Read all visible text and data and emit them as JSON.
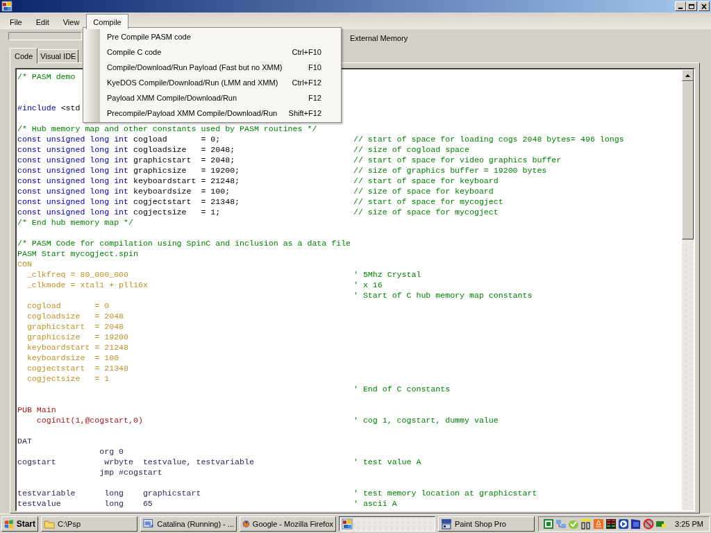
{
  "progress": {
    "level": 0
  },
  "menus": [
    {
      "label": "File",
      "selected": false
    },
    {
      "label": "Edit",
      "selected": false
    },
    {
      "label": "View",
      "selected": false
    },
    {
      "label": "Compile",
      "selected": true,
      "items": [
        {
          "label": "Pre Compile PASM code"
        },
        {
          "label": "Compile C code",
          "shortcut": "Ctrl+F10"
        },
        {
          "label": "Compile/Download/Run Payload (Fast but no XMM)",
          "shortcut": "F10"
        },
        {
          "label": "KyeDOS Compile/Download/Run (LMM and XMM)",
          "shortcut": "Ctrl+F12"
        },
        {
          "label": "Payload XMM Compile/Download/Run",
          "shortcut": "F12"
        },
        {
          "label": "Precompile/Payload XMM Compile/Download/Run",
          "shortcut": "Shift+F12"
        }
      ]
    }
  ],
  "toolbar": {
    "option_label": "External Memory"
  },
  "tabs": [
    {
      "label": "Code",
      "selected": true
    },
    {
      "label": "Visual IDE",
      "selected": false
    }
  ],
  "code_lines": [
    {
      "segments": [
        {
          "kind": "comment",
          "text": "/* PASM demo"
        }
      ]
    },
    {
      "kind": "blank"
    },
    {
      "kind": "blank"
    },
    {
      "segments": [
        {
          "kind": "keyword",
          "text": "#include"
        },
        {
          "kind": "plain",
          "text": " <std"
        }
      ]
    },
    {
      "kind": "blank"
    },
    {
      "segments": [
        {
          "kind": "comment",
          "text": "/* Hub memory map and other constants used by PASM routines */"
        }
      ]
    },
    {
      "segments": [
        {
          "kind": "keyword",
          "text": "const unsigned long int"
        },
        {
          "kind": "plain",
          "text": " cogload       = 0;"
        }
      ],
      "note": "// start of space for loading cogs 2048 bytes= 496 longs"
    },
    {
      "segments": [
        {
          "kind": "keyword",
          "text": "const unsigned long int"
        },
        {
          "kind": "plain",
          "text": " cogloadsize   = 2048;"
        }
      ],
      "note": "// size of cogload space"
    },
    {
      "segments": [
        {
          "kind": "keyword",
          "text": "const unsigned long int"
        },
        {
          "kind": "plain",
          "text": " graphicstart  = 2048;"
        }
      ],
      "note": "// start of space for video graphics buffer"
    },
    {
      "segments": [
        {
          "kind": "keyword",
          "text": "const unsigned long int"
        },
        {
          "kind": "plain",
          "text": " graphicsize   = 19200;"
        }
      ],
      "note": "// size of graphics buffer = 19200 bytes"
    },
    {
      "segments": [
        {
          "kind": "keyword",
          "text": "const unsigned long int"
        },
        {
          "kind": "plain",
          "text": " keyboardstart = 21248;"
        }
      ],
      "note": "// start of space for keyboard"
    },
    {
      "segments": [
        {
          "kind": "keyword",
          "text": "const unsigned long int"
        },
        {
          "kind": "plain",
          "text": " keyboardsize  = 100;"
        }
      ],
      "note": "// size of space for keyboard"
    },
    {
      "segments": [
        {
          "kind": "keyword",
          "text": "const unsigned long int"
        },
        {
          "kind": "plain",
          "text": " cogjectstart  = 21348;"
        }
      ],
      "note": "// start of space for mycogject"
    },
    {
      "segments": [
        {
          "kind": "keyword",
          "text": "const unsigned long int"
        },
        {
          "kind": "plain",
          "text": " cogjectsize   = 1;"
        }
      ],
      "note": "// size of space for mycogject"
    },
    {
      "segments": [
        {
          "kind": "comment",
          "text": "/* End hub memory map */"
        }
      ]
    },
    {
      "kind": "blank"
    },
    {
      "segments": [
        {
          "kind": "comment",
          "text": "/* PASM Code for compilation using SpinC and inclusion as a data file"
        }
      ]
    },
    {
      "segments": [
        {
          "kind": "comment",
          "text": "PASM Start mycogject.spin"
        }
      ]
    },
    {
      "segments": [
        {
          "kind": "spin",
          "text": "CON"
        }
      ]
    },
    {
      "segments": [
        {
          "kind": "spin",
          "text": "  _clkfreq = 80_000_000"
        }
      ],
      "note": "' 5Mhz Crystal"
    },
    {
      "segments": [
        {
          "kind": "spin",
          "text": "  _clkmode = xtal1 + pll16x"
        }
      ],
      "note": "' x 16"
    },
    {
      "note": "' Start of C hub memory map constants"
    },
    {
      "segments": [
        {
          "kind": "spin",
          "text": "  cogload       = 0"
        }
      ]
    },
    {
      "segments": [
        {
          "kind": "spin",
          "text": "  cogloadsize   = 2048"
        }
      ]
    },
    {
      "segments": [
        {
          "kind": "spin",
          "text": "  graphicstart  = 2048"
        }
      ]
    },
    {
      "segments": [
        {
          "kind": "spin",
          "text": "  graphicsize   = 19200"
        }
      ]
    },
    {
      "segments": [
        {
          "kind": "spin",
          "text": "  keyboardstart = 21248"
        }
      ]
    },
    {
      "segments": [
        {
          "kind": "spin",
          "text": "  keyboardsize  = 100"
        }
      ]
    },
    {
      "segments": [
        {
          "kind": "spin",
          "text": "  cogjectstart  = 21348"
        }
      ]
    },
    {
      "segments": [
        {
          "kind": "spin",
          "text": "  cogjectsize   = 1"
        }
      ]
    },
    {
      "note": "' End of C constants"
    },
    {
      "kind": "blank"
    },
    {
      "segments": [
        {
          "kind": "pub",
          "text": "PUB Main"
        }
      ]
    },
    {
      "segments": [
        {
          "kind": "pub",
          "text": "    coginit(1,@cogstart,0)"
        }
      ],
      "note": "' cog 1, cogstart, dummy value"
    },
    {
      "kind": "blank"
    },
    {
      "segments": [
        {
          "kind": "dat",
          "text": "DAT"
        }
      ]
    },
    {
      "segments": [
        {
          "kind": "dat",
          "text": "                 org 0"
        }
      ]
    },
    {
      "segments": [
        {
          "kind": "dat",
          "text": "cogstart          wrbyte  testvalue, testvariable"
        }
      ],
      "note": "' test value A"
    },
    {
      "segments": [
        {
          "kind": "dat",
          "text": "                 jmp #cogstart"
        }
      ]
    },
    {
      "kind": "blank"
    },
    {
      "segments": [
        {
          "kind": "dat",
          "text": "testvariable      long    graphicstart"
        }
      ],
      "note": "' test memory location at graphicstart"
    },
    {
      "segments": [
        {
          "kind": "dat",
          "text": "testvalue         long    65"
        }
      ],
      "note": "' ascii A"
    }
  ],
  "taskbar": {
    "start_label": "Start",
    "tasks": [
      {
        "kind": "folder",
        "label": "C:\\Psp",
        "selected": false
      },
      {
        "kind": "vb",
        "label": "Catalina (Running) - ...",
        "selected": false
      },
      {
        "kind": "firefox",
        "label": "Google - Mozilla Firefox",
        "selected": false
      },
      {
        "kind": "app",
        "selected": true
      },
      {
        "kind": "paint",
        "label": "Paint Shop Pro",
        "selected": false
      }
    ],
    "clock": "3:25 PM"
  }
}
